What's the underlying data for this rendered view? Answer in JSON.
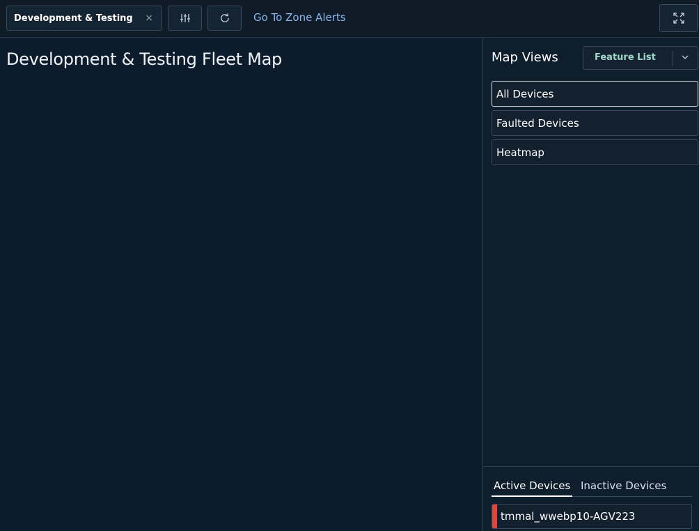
{
  "topbar": {
    "zone_select_value": "Development & Testing",
    "clear_glyph": "×",
    "filter_icon": "sliders-icon",
    "refresh_icon": "refresh-icon",
    "zone_alerts_link": "Go To Zone Alerts",
    "expand_icon": "expand-icon"
  },
  "map": {
    "title": "Development & Testing Fleet Map"
  },
  "sidebar": {
    "title": "Map Views",
    "feature_select_value": "Feature List",
    "views": [
      {
        "label": "All Devices",
        "active": true
      },
      {
        "label": "Faulted Devices",
        "active": false
      },
      {
        "label": "Heatmap",
        "active": false
      }
    ],
    "device_tabs": [
      {
        "label": "Active Devices",
        "active": true
      },
      {
        "label": "Inactive Devices",
        "active": false
      }
    ],
    "devices": [
      {
        "name": "tmmal_wwebp10-AGV223",
        "status_color": "#e0453a"
      }
    ]
  },
  "colors": {
    "accent_link": "#8ab4ec",
    "fault_status": "#e0453a",
    "feature_label": "#9fd8c8"
  }
}
